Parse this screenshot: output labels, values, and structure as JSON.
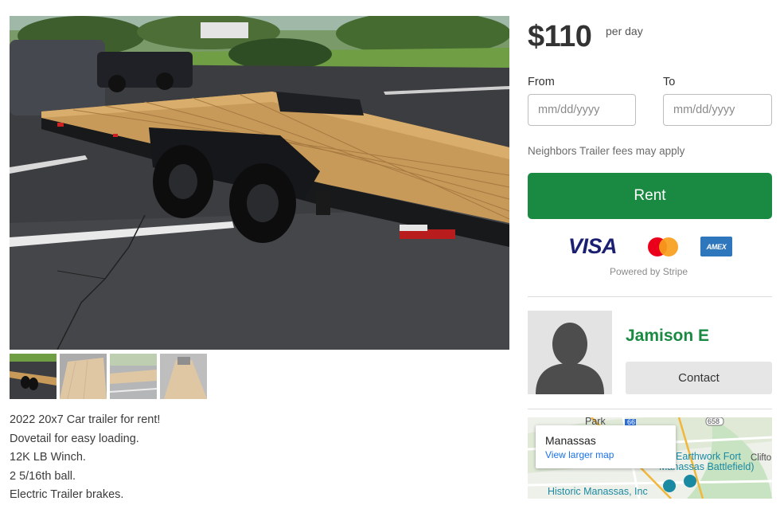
{
  "listing": {
    "thumbnails": [
      "thumb-1",
      "thumb-2",
      "thumb-3",
      "thumb-4"
    ],
    "description": [
      "2022 20x7 Car trailer for rent!",
      "Dovetail for easy loading.",
      "12K LB Winch.",
      "2 5/16th ball.",
      "Electric Trailer brakes."
    ]
  },
  "booking": {
    "price": "$110",
    "price_unit": "per day",
    "from_label": "From",
    "to_label": "To",
    "from_placeholder": "mm/dd/yyyy",
    "to_placeholder": "mm/dd/yyyy",
    "fees_note": "Neighbors Trailer fees may apply",
    "rent_label": "Rent",
    "payment": {
      "visa": "VISA",
      "amex": "AMEX",
      "powered_by": "Powered by Stripe"
    }
  },
  "owner": {
    "name": "Jamison E",
    "contact_label": "Contact"
  },
  "map": {
    "city": "Manassas",
    "link_label": "View larger map",
    "labels": {
      "park": "Park",
      "route": "66",
      "route2": "658",
      "earthwork": "Earthwork Fort",
      "battlefield": "Manassas Battlefield)",
      "clifton": "Clifto",
      "historic": "Historic Manassas, Inc"
    }
  },
  "colors": {
    "brand_green": "#1a8a42",
    "map_link": "#1a73e8"
  }
}
